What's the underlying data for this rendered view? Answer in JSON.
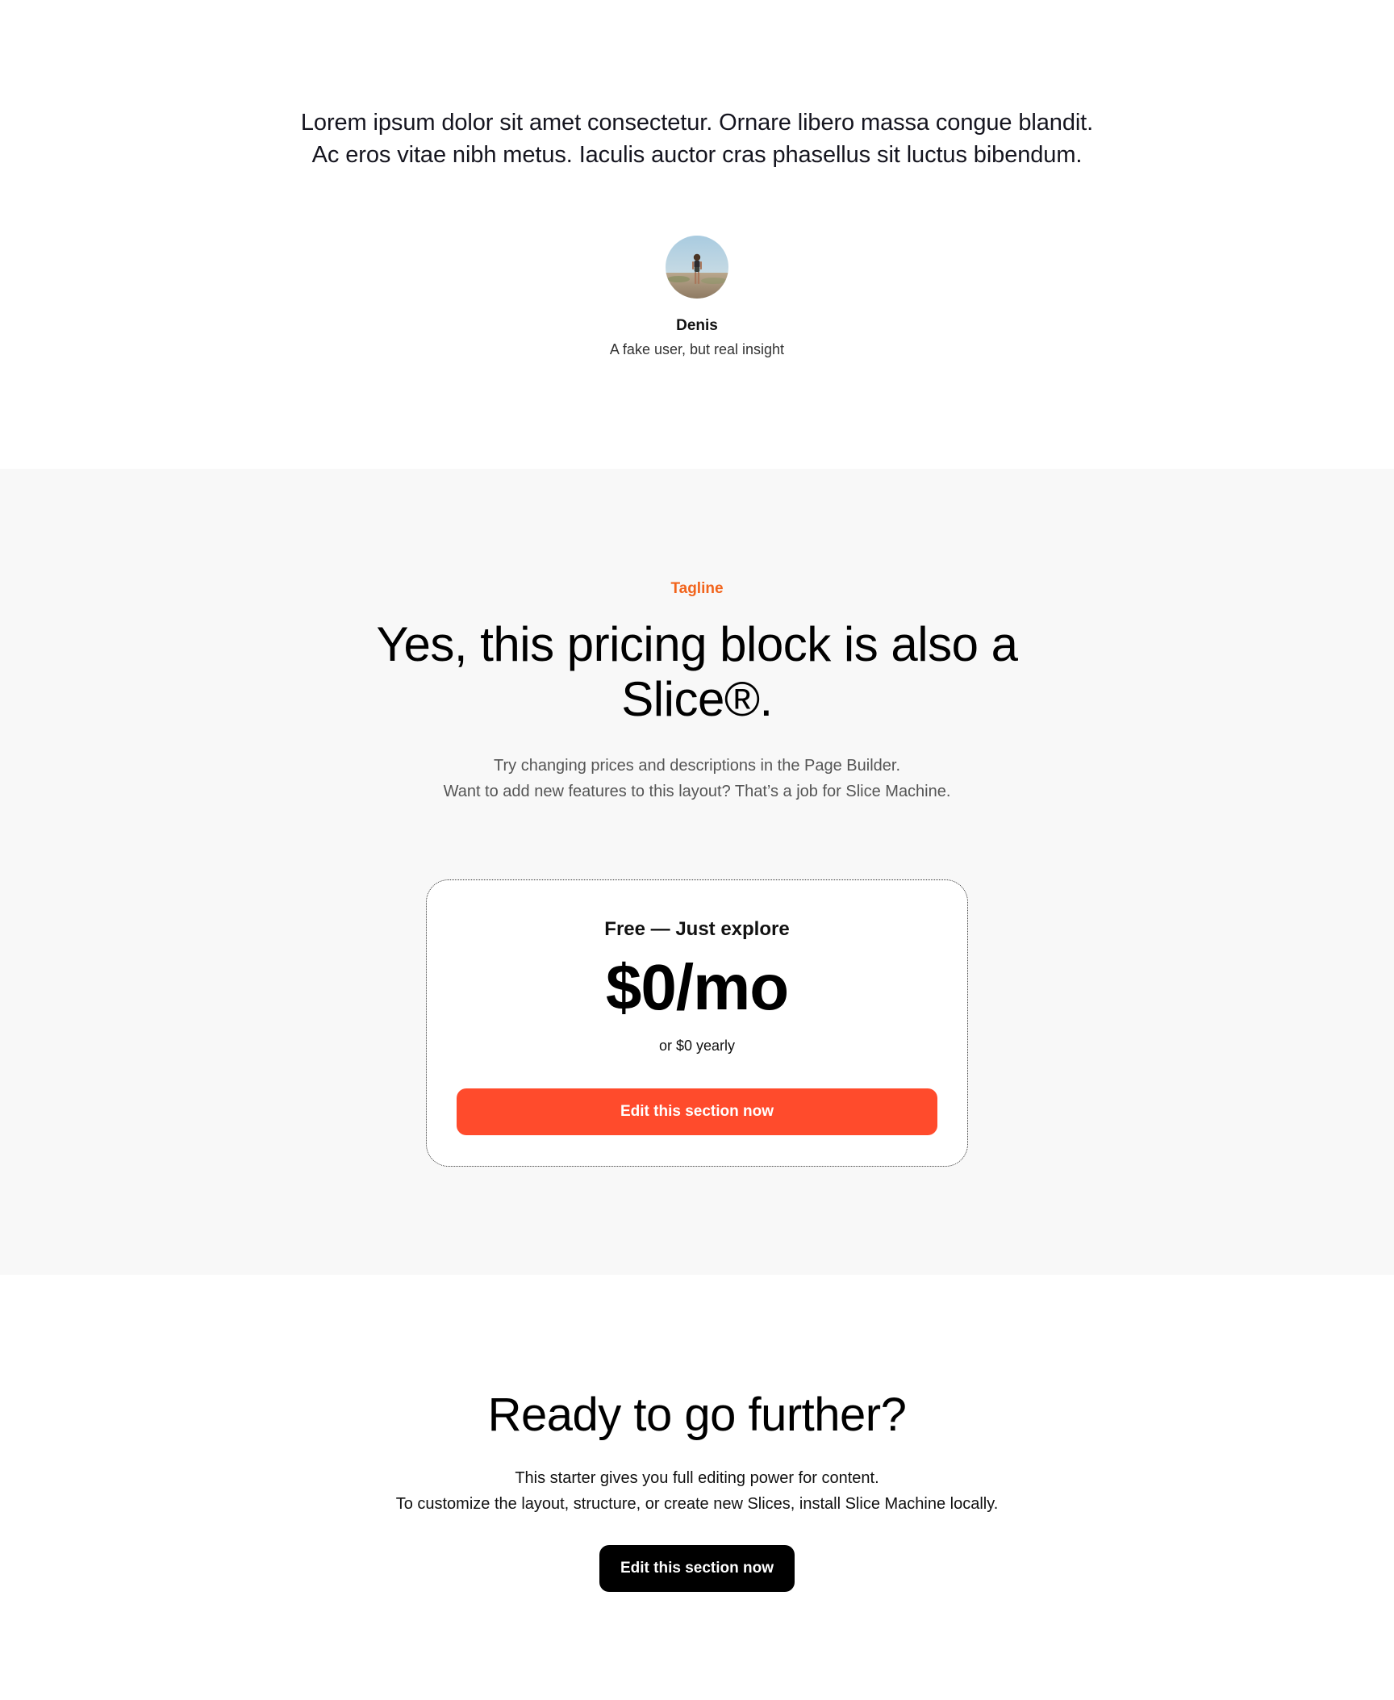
{
  "testimonial": {
    "quote": "Lorem ipsum dolor sit amet consectetur. Ornare libero massa congue blandit. Ac eros vitae nibh metus. Iaculis auctor cras phasellus sit luctus bibendum.",
    "author_name": "Denis",
    "author_role": "A fake user, but real insight"
  },
  "pricing": {
    "tagline": "Tagline",
    "title_line1": "Yes, this pricing block is also a",
    "title_line2": "Slice®.",
    "subtitle_line1": "Try changing prices and descriptions in the Page Builder.",
    "subtitle_line2": "Want to add new features to this layout? That’s a job for Slice Machine.",
    "card": {
      "plan_name": "Free — Just explore",
      "price": "$0/mo",
      "yearly": "or $0 yearly",
      "button_label": "Edit this section now"
    }
  },
  "cta": {
    "title": "Ready to go further?",
    "text_line1": "This starter gives you full editing power for content.",
    "text_line2": "To customize the layout, structure, or create new Slices, install Slice Machine locally.",
    "button_label": "Edit this section now"
  },
  "colors": {
    "accent_orange": "#f2641c",
    "button_red": "#ff4b2c",
    "section_gray": "#f8f8f8",
    "button_black": "#000000"
  },
  "icons": {
    "avatar": "avatar-photo"
  }
}
